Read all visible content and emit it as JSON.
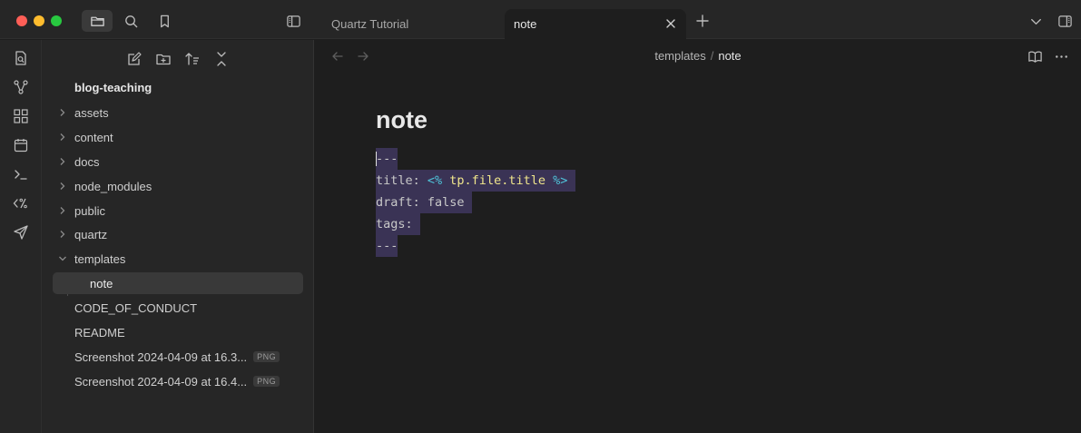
{
  "tabs": [
    {
      "label": "Quartz Tutorial"
    },
    {
      "label": "note"
    }
  ],
  "sidebar": {
    "vault_name": "blog-teaching",
    "tree": [
      {
        "label": "assets",
        "type": "folder"
      },
      {
        "label": "content",
        "type": "folder"
      },
      {
        "label": "docs",
        "type": "folder"
      },
      {
        "label": "node_modules",
        "type": "folder"
      },
      {
        "label": "public",
        "type": "folder"
      },
      {
        "label": "quartz",
        "type": "folder"
      },
      {
        "label": "templates",
        "type": "folder-open"
      },
      {
        "label": "note",
        "type": "file-selected"
      },
      {
        "label": "CODE_OF_CONDUCT",
        "type": "file"
      },
      {
        "label": "README",
        "type": "file"
      },
      {
        "label": "Screenshot 2024-04-09 at 16.3...",
        "type": "file",
        "badge": "PNG"
      },
      {
        "label": "Screenshot 2024-04-09 at 16.4...",
        "type": "file",
        "badge": "PNG"
      }
    ]
  },
  "breadcrumb": {
    "parent": "templates",
    "separator": "/",
    "current": "note"
  },
  "note": {
    "title": "note",
    "lines": {
      "l1": "---",
      "l2_key": "title: ",
      "l2_open": "<%",
      "l2_fn": " tp.file.title ",
      "l2_close": "%>",
      "l3": "draft: false",
      "l4": "tags:",
      "l5": "---"
    }
  },
  "colors": {
    "selection": "#3a3355",
    "template_tag": "#4fc3d9",
    "template_expr": "#f0e68c"
  }
}
